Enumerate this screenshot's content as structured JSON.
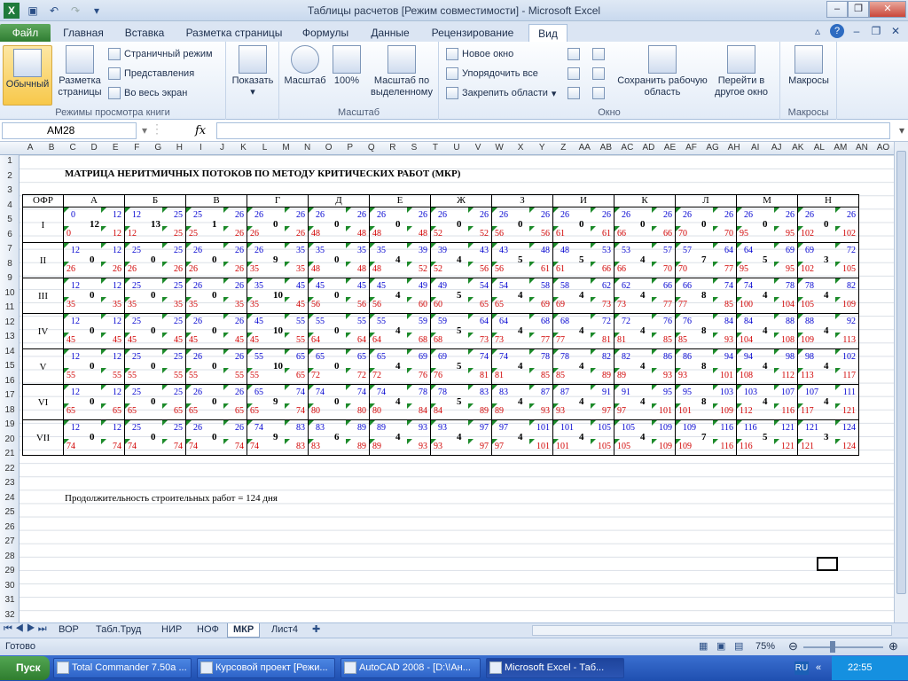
{
  "window": {
    "title": "Таблицы расчетов  [Режим совместимости]  -  Microsoft Excel"
  },
  "tabs": [
    "Файл",
    "Главная",
    "Вставка",
    "Разметка страницы",
    "Формулы",
    "Данные",
    "Рецензирование",
    "Вид"
  ],
  "ribbon": {
    "views": {
      "label": "Режимы просмотра книги",
      "normal": "Обычный",
      "page_layout": "Разметка страницы",
      "page_break": "Страничный режим",
      "custom": "Представления",
      "full_screen": "Во весь экран",
      "show": "Показать"
    },
    "zoom": {
      "label": "Масштаб",
      "zoom": "Масштаб",
      "z100": "100%",
      "selection": "Масштаб по выделенному"
    },
    "window": {
      "label": "Окно",
      "new": "Новое окно",
      "arrange": "Упорядочить все",
      "freeze": "Закрепить области",
      "save_ws": "Сохранить рабочую область",
      "switch": "Перейти в другое окно"
    },
    "macros": {
      "label": "Макросы",
      "macros": "Макросы"
    }
  },
  "formula_bar": {
    "name_box": "AM28",
    "fx": "fx",
    "value": ""
  },
  "columns": [
    "A",
    "B",
    "C",
    "D",
    "E",
    "F",
    "G",
    "H",
    "I",
    "J",
    "K",
    "L",
    "M",
    "N",
    "O",
    "P",
    "Q",
    "R",
    "S",
    "T",
    "U",
    "V",
    "W",
    "X",
    "Y",
    "Z",
    "AA",
    "AB",
    "AC",
    "AD",
    "AE",
    "AF",
    "AG",
    "AH",
    "AI",
    "AJ",
    "AK",
    "AL",
    "AM",
    "AN",
    "AO"
  ],
  "rows": [
    "1",
    "2",
    "3",
    "4",
    "5",
    "6",
    "7",
    "8",
    "9",
    "10",
    "11",
    "12",
    "13",
    "14",
    "15",
    "16",
    "17",
    "18",
    "19",
    "20",
    "21",
    "22",
    "23",
    "24",
    "25",
    "26",
    "27",
    "28",
    "29",
    "30",
    "31",
    "32"
  ],
  "sheet": {
    "title": "МАТРИЦА НЕРИТМИЧНЫХ ПОТОКОВ ПО МЕТОДУ КРИТИЧЕСКИХ РАБОТ (МКР)",
    "footnote": "Продолжительность строительных работ = 124 дня",
    "corner": "ОФР",
    "headers": [
      "А",
      "Б",
      "В",
      "Г",
      "Д",
      "Е",
      "Ж",
      "З",
      "И",
      "К",
      "Л",
      "М",
      "Н"
    ],
    "rows": [
      {
        "label": "I",
        "cells": [
          [
            "0",
            "12",
            "12",
            "0",
            "12"
          ],
          [
            "12",
            "13",
            "25",
            "12",
            "25"
          ],
          [
            "25",
            "1",
            "26",
            "25",
            "26"
          ],
          [
            "26",
            "0",
            "26",
            "26",
            "26"
          ],
          [
            "26",
            "0",
            "26",
            "48",
            "48"
          ],
          [
            "26",
            "0",
            "26",
            "48",
            "48"
          ],
          [
            "26",
            "0",
            "26",
            "52",
            "52"
          ],
          [
            "26",
            "0",
            "26",
            "56",
            "56"
          ],
          [
            "26",
            "0",
            "26",
            "61",
            "61"
          ],
          [
            "26",
            "0",
            "26",
            "66",
            "66"
          ],
          [
            "26",
            "0",
            "26",
            "70",
            "70"
          ],
          [
            "26",
            "0",
            "26",
            "95",
            "95"
          ],
          [
            "26",
            "0",
            "26",
            "102",
            "102"
          ]
        ]
      },
      {
        "label": "II",
        "cells": [
          [
            "12",
            "0",
            "12",
            "26",
            "26"
          ],
          [
            "25",
            "0",
            "25",
            "26",
            "26"
          ],
          [
            "26",
            "0",
            "26",
            "26",
            "26"
          ],
          [
            "26",
            "9",
            "35",
            "35",
            "35"
          ],
          [
            "35",
            "0",
            "35",
            "48",
            "48"
          ],
          [
            "35",
            "4",
            "39",
            "48",
            "52"
          ],
          [
            "39",
            "4",
            "43",
            "52",
            "56"
          ],
          [
            "43",
            "5",
            "48",
            "56",
            "61"
          ],
          [
            "48",
            "5",
            "53",
            "61",
            "66"
          ],
          [
            "53",
            "4",
            "57",
            "66",
            "70"
          ],
          [
            "57",
            "7",
            "64",
            "70",
            "77"
          ],
          [
            "64",
            "5",
            "69",
            "95",
            "95"
          ],
          [
            "69",
            "3",
            "72",
            "102",
            "105"
          ]
        ]
      },
      {
        "label": "III",
        "cells": [
          [
            "12",
            "0",
            "12",
            "35",
            "35"
          ],
          [
            "25",
            "0",
            "25",
            "35",
            "35"
          ],
          [
            "26",
            "0",
            "26",
            "35",
            "35"
          ],
          [
            "35",
            "10",
            "45",
            "35",
            "45"
          ],
          [
            "45",
            "0",
            "45",
            "56",
            "56"
          ],
          [
            "45",
            "4",
            "49",
            "56",
            "60"
          ],
          [
            "49",
            "5",
            "54",
            "60",
            "65"
          ],
          [
            "54",
            "4",
            "58",
            "65",
            "69"
          ],
          [
            "58",
            "4",
            "62",
            "69",
            "73"
          ],
          [
            "62",
            "4",
            "66",
            "73",
            "77"
          ],
          [
            "66",
            "8",
            "74",
            "77",
            "85"
          ],
          [
            "74",
            "4",
            "78",
            "100",
            "104"
          ],
          [
            "78",
            "4",
            "82",
            "105",
            "109"
          ]
        ]
      },
      {
        "label": "IV",
        "cells": [
          [
            "12",
            "0",
            "12",
            "45",
            "45"
          ],
          [
            "25",
            "0",
            "25",
            "45",
            "45"
          ],
          [
            "26",
            "0",
            "26",
            "45",
            "45"
          ],
          [
            "45",
            "10",
            "55",
            "45",
            "55"
          ],
          [
            "55",
            "0",
            "55",
            "64",
            "64"
          ],
          [
            "55",
            "4",
            "59",
            "64",
            "68"
          ],
          [
            "59",
            "5",
            "64",
            "68",
            "73"
          ],
          [
            "64",
            "4",
            "68",
            "73",
            "77"
          ],
          [
            "68",
            "4",
            "72",
            "77",
            "81"
          ],
          [
            "72",
            "4",
            "76",
            "81",
            "85"
          ],
          [
            "76",
            "8",
            "84",
            "85",
            "93"
          ],
          [
            "84",
            "4",
            "88",
            "104",
            "108"
          ],
          [
            "88",
            "4",
            "92",
            "109",
            "113"
          ]
        ]
      },
      {
        "label": "V",
        "cells": [
          [
            "12",
            "0",
            "12",
            "55",
            "55"
          ],
          [
            "25",
            "0",
            "25",
            "55",
            "55"
          ],
          [
            "26",
            "0",
            "26",
            "55",
            "55"
          ],
          [
            "55",
            "10",
            "65",
            "55",
            "65"
          ],
          [
            "65",
            "0",
            "65",
            "72",
            "72"
          ],
          [
            "65",
            "4",
            "69",
            "72",
            "76"
          ],
          [
            "69",
            "5",
            "74",
            "76",
            "81"
          ],
          [
            "74",
            "4",
            "78",
            "81",
            "85"
          ],
          [
            "78",
            "4",
            "82",
            "85",
            "89"
          ],
          [
            "82",
            "4",
            "86",
            "89",
            "93"
          ],
          [
            "86",
            "8",
            "94",
            "93",
            "101"
          ],
          [
            "94",
            "4",
            "98",
            "108",
            "112"
          ],
          [
            "98",
            "4",
            "102",
            "113",
            "117"
          ]
        ]
      },
      {
        "label": "VI",
        "cells": [
          [
            "12",
            "0",
            "12",
            "65",
            "65"
          ],
          [
            "25",
            "0",
            "25",
            "65",
            "65"
          ],
          [
            "26",
            "0",
            "26",
            "65",
            "65"
          ],
          [
            "65",
            "9",
            "74",
            "65",
            "74"
          ],
          [
            "74",
            "0",
            "74",
            "80",
            "80"
          ],
          [
            "74",
            "4",
            "78",
            "80",
            "84"
          ],
          [
            "78",
            "5",
            "83",
            "84",
            "89"
          ],
          [
            "83",
            "4",
            "87",
            "89",
            "93"
          ],
          [
            "87",
            "4",
            "91",
            "93",
            "97"
          ],
          [
            "91",
            "4",
            "95",
            "97",
            "101"
          ],
          [
            "95",
            "8",
            "103",
            "101",
            "109"
          ],
          [
            "103",
            "4",
            "107",
            "112",
            "116"
          ],
          [
            "107",
            "4",
            "111",
            "117",
            "121"
          ]
        ]
      },
      {
        "label": "VII",
        "cells": [
          [
            "12",
            "0",
            "12",
            "74",
            "74"
          ],
          [
            "25",
            "0",
            "25",
            "74",
            "74"
          ],
          [
            "26",
            "0",
            "26",
            "74",
            "74"
          ],
          [
            "74",
            "9",
            "83",
            "74",
            "83"
          ],
          [
            "83",
            "6",
            "89",
            "83",
            "89"
          ],
          [
            "89",
            "4",
            "93",
            "89",
            "93"
          ],
          [
            "93",
            "4",
            "97",
            "93",
            "97"
          ],
          [
            "97",
            "4",
            "101",
            "97",
            "101"
          ],
          [
            "101",
            "4",
            "105",
            "101",
            "105"
          ],
          [
            "105",
            "4",
            "109",
            "105",
            "109"
          ],
          [
            "109",
            "7",
            "116",
            "109",
            "116"
          ],
          [
            "116",
            "5",
            "121",
            "116",
            "121"
          ],
          [
            "121",
            "3",
            "124",
            "121",
            "124"
          ]
        ]
      }
    ]
  },
  "sheet_tabs": [
    "ВОР",
    "Табл.Труд",
    "НИР",
    "НОФ",
    "МКР",
    "Лист4"
  ],
  "status": {
    "ready": "Готово",
    "zoom": "75%"
  },
  "taskbar": {
    "start": "Пуск",
    "tasks": [
      "Total Commander 7.50a ...",
      "Курсовой проект [Режи...",
      "AutoCAD 2008 - [D:\\!Ан...",
      "Microsoft Excel - Таб..."
    ],
    "lang": "RU",
    "time": "22:55"
  }
}
